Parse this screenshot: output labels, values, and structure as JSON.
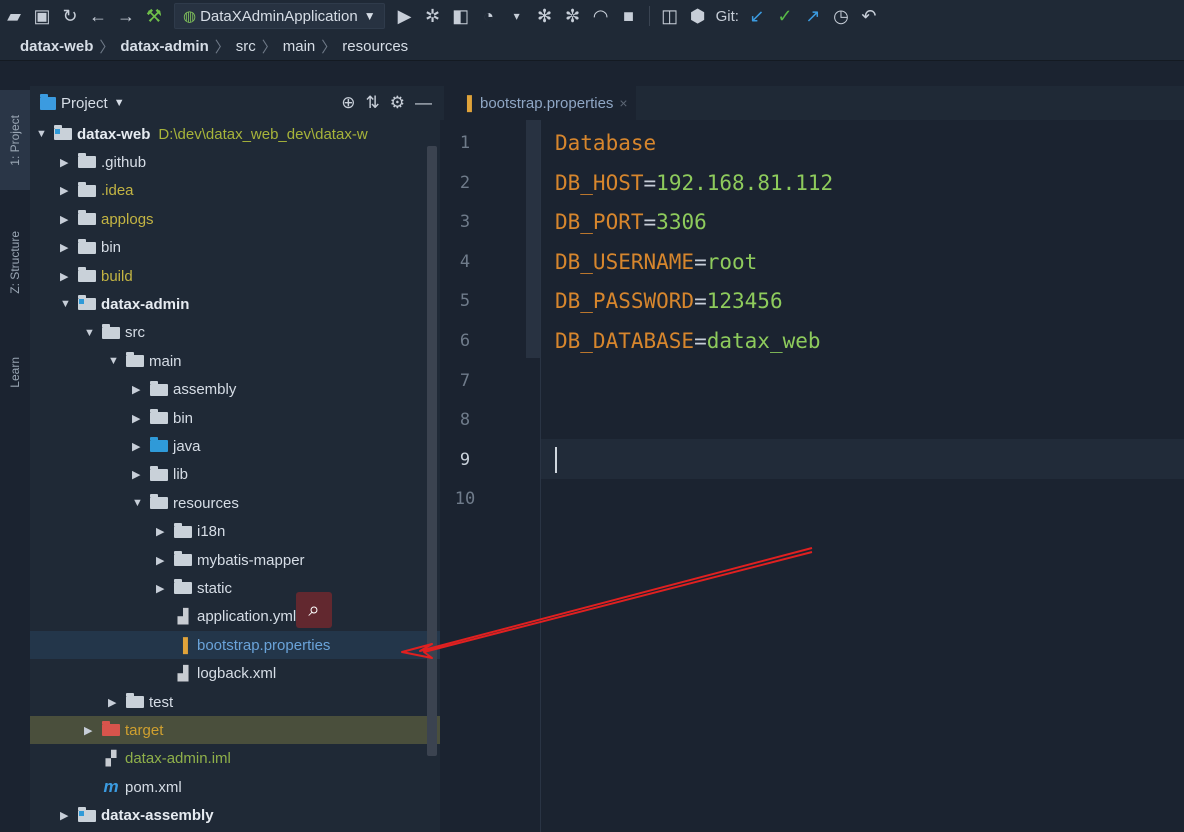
{
  "toolbar": {
    "run_config": "DataXAdminApplication",
    "git_label": "Git:"
  },
  "breadcrumb": [
    "datax-web",
    "datax-admin",
    "src",
    "main",
    "resources"
  ],
  "tool_windows": {
    "project": "1: Project",
    "structure": "Z: Structure",
    "learn": "Learn"
  },
  "project_panel": {
    "title": "Project",
    "tree": [
      {
        "label": "datax-web",
        "extra": "D:\\dev\\datax_web_dev\\datax-w",
        "arrow": "▼",
        "icon": "module-folder",
        "style": "bold"
      },
      {
        "label": ".github",
        "arrow": "▶",
        "icon": "folder",
        "style": "default"
      },
      {
        "label": ".idea",
        "arrow": "▶",
        "icon": "folder",
        "style": "yellow"
      },
      {
        "label": "applogs",
        "arrow": "▶",
        "icon": "folder",
        "style": "yellow"
      },
      {
        "label": "bin",
        "arrow": "▶",
        "icon": "folder",
        "style": "default"
      },
      {
        "label": "build",
        "arrow": "▶",
        "icon": "folder",
        "style": "yellow"
      },
      {
        "label": "datax-admin",
        "arrow": "▼",
        "icon": "module-folder",
        "style": "bold"
      },
      {
        "label": "src",
        "arrow": "▼",
        "icon": "folder",
        "style": "default"
      },
      {
        "label": "main",
        "arrow": "▼",
        "icon": "folder",
        "style": "default"
      },
      {
        "label": "assembly",
        "arrow": "▶",
        "icon": "folder",
        "style": "default"
      },
      {
        "label": "bin",
        "arrow": "▶",
        "icon": "folder",
        "style": "default"
      },
      {
        "label": "java",
        "arrow": "▶",
        "icon": "source-folder",
        "style": "default"
      },
      {
        "label": "lib",
        "arrow": "▶",
        "icon": "folder",
        "style": "default"
      },
      {
        "label": "resources",
        "arrow": "▼",
        "icon": "resources-folder",
        "style": "default"
      },
      {
        "label": "i18n",
        "arrow": "▶",
        "icon": "folder",
        "style": "default"
      },
      {
        "label": "mybatis-mapper",
        "arrow": "▶",
        "icon": "folder",
        "style": "default"
      },
      {
        "label": "static",
        "arrow": "▶",
        "icon": "folder",
        "style": "default"
      },
      {
        "label": "application.yml",
        "arrow": "",
        "icon": "yml-file",
        "style": "default"
      },
      {
        "label": "bootstrap.properties",
        "arrow": "",
        "icon": "properties-file",
        "style": "blue"
      },
      {
        "label": "logback.xml",
        "arrow": "",
        "icon": "xml-file",
        "style": "default"
      },
      {
        "label": "test",
        "arrow": "▶",
        "icon": "folder",
        "style": "default"
      },
      {
        "label": "target",
        "arrow": "▶",
        "icon": "excluded-folder",
        "style": "orange"
      },
      {
        "label": "datax-admin.iml",
        "arrow": "",
        "icon": "iml-file",
        "style": "green"
      },
      {
        "label": "pom.xml",
        "arrow": "",
        "icon": "maven-file",
        "style": "default"
      },
      {
        "label": "datax-assembly",
        "arrow": "▶",
        "icon": "module-folder",
        "style": "bold"
      }
    ]
  },
  "editor": {
    "tab_label": "bootstrap.properties",
    "line_numbers": [
      "1",
      "2",
      "3",
      "4",
      "5",
      "6",
      "7",
      "8",
      "9",
      "10"
    ],
    "current_line": "9",
    "lines": [
      {
        "key": "Database",
        "eq": "",
        "value": ""
      },
      {
        "key": "DB_HOST",
        "eq": "=",
        "value": "192.168.81.112"
      },
      {
        "key": "DB_PORT",
        "eq": "=",
        "value": "3306"
      },
      {
        "key": "DB_USERNAME",
        "eq": "=",
        "value": "root"
      },
      {
        "key": "DB_PASSWORD",
        "eq": "=",
        "value": "123456"
      },
      {
        "key": "DB_DATABASE",
        "eq": "=",
        "value": "datax_web"
      }
    ]
  },
  "colors": {
    "annotation_arrow": "#e02020"
  }
}
